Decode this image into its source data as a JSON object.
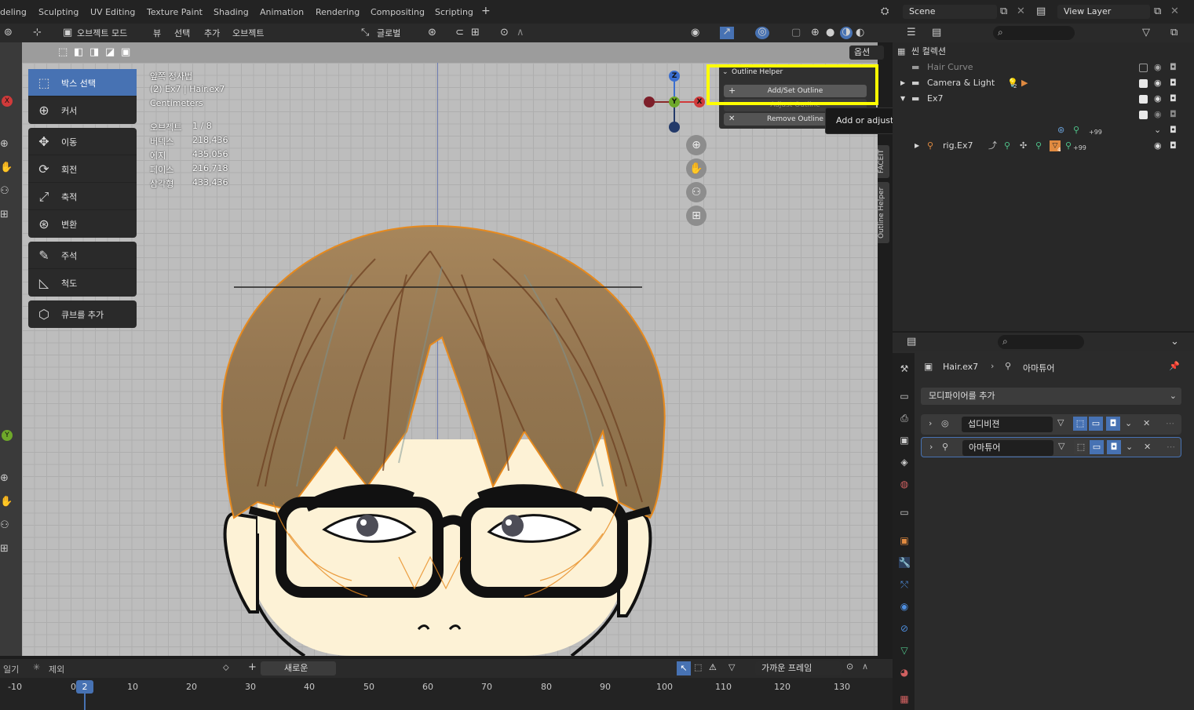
{
  "workspaces": [
    "deling",
    "Sculpting",
    "UV Editing",
    "Texture Paint",
    "Shading",
    "Animation",
    "Rendering",
    "Compositing",
    "Scripting"
  ],
  "add_workspace": "+",
  "scene": {
    "label": "Scene"
  },
  "view_layer": {
    "label": "View Layer"
  },
  "viewport_header": {
    "mode": "오브젝트 모드",
    "menus": [
      "뷰",
      "선택",
      "추가",
      "오브젝트"
    ],
    "orientation": "글로벌"
  },
  "options_label": "옵션",
  "toolbar": {
    "groups": [
      [
        "박스 선택",
        "커서"
      ],
      [
        "이동",
        "회전",
        "축적",
        "변환"
      ],
      [
        "주석",
        "척도"
      ],
      [
        "큐브를 추가"
      ]
    ]
  },
  "overlay": {
    "view_name": "앞쪽 정사법",
    "object_info": "(2) Ex7 | Hair.ex7",
    "units": "Centimeters",
    "stats": [
      {
        "label": "오브젝트",
        "value": "1 / 8"
      },
      {
        "label": "버텍스",
        "value": "218,436"
      },
      {
        "label": "에지",
        "value": "435,056"
      },
      {
        "label": "페이스",
        "value": "216,718"
      },
      {
        "label": "삼각형",
        "value": "433,436"
      }
    ]
  },
  "gizmo": {
    "z": "Z",
    "y": "Y",
    "x": "X"
  },
  "outline_helper": {
    "title": "Outline Helper",
    "add_set": "Add/Set Outline",
    "adjust": "Adjust Outline",
    "remove": "Remove Outline",
    "tooltip": "Add or adjust geometry outline of selected objects."
  },
  "side_tabs": [
    "FACEIT",
    "Outline Helper"
  ],
  "outliner": {
    "root": "씬 컬렉션",
    "rows": [
      {
        "name": "Hair Curve",
        "dim": true
      },
      {
        "name": "Camera & Light",
        "dim": false
      },
      {
        "name": "Ex7",
        "dim": false
      },
      {
        "name": "rig.Ex7",
        "dim": false
      }
    ],
    "badges": {
      "camera_count": "2",
      "plus99": "+99",
      "rig_count": "4"
    }
  },
  "properties": {
    "breadcrumb_object": "Hair.ex7",
    "breadcrumb_modifier": "아마튜어",
    "add_modifier": "모디파이어를 추가",
    "modifiers": [
      "섭디비젼",
      "아마튜어"
    ]
  },
  "timeline": {
    "left_label_1": "일기",
    "left_label_2": "제외",
    "new_label": "새로운",
    "keying": "가까운 프레임",
    "current_frame": "2",
    "ticks": [
      "-10",
      "0",
      "10",
      "20",
      "30",
      "40",
      "50",
      "60",
      "70",
      "80",
      "90",
      "100",
      "110",
      "120",
      "130"
    ]
  }
}
